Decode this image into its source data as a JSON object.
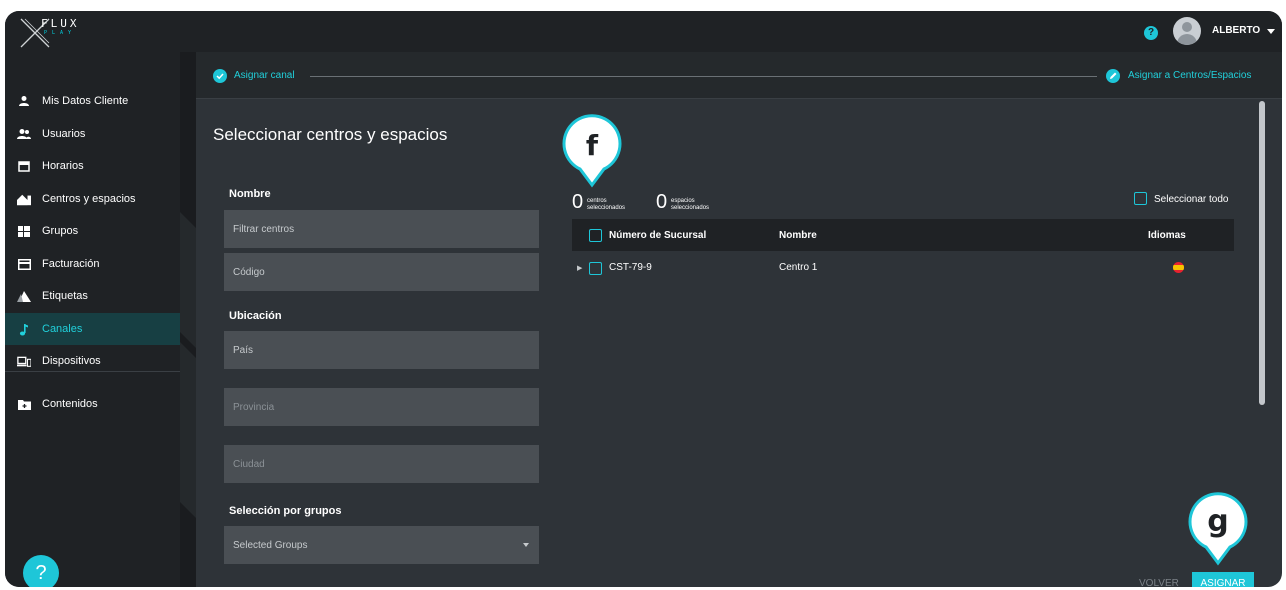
{
  "app": {
    "logo_text": "FLUX",
    "logo_sub": "PLAY"
  },
  "header": {
    "help_icon": "question-circle-icon",
    "user_name": "ALBERTO"
  },
  "sidebar": {
    "items": [
      {
        "label": "Mis Datos Cliente",
        "icon": "user-icon"
      },
      {
        "label": "Usuarios",
        "icon": "users-icon"
      },
      {
        "label": "Horarios",
        "icon": "calendar-icon"
      },
      {
        "label": "Centros y espacios",
        "icon": "building-icon"
      },
      {
        "label": "Grupos",
        "icon": "grid-icon"
      },
      {
        "label": "Facturación",
        "icon": "card-icon"
      },
      {
        "label": "Etiquetas",
        "icon": "tags-icon"
      },
      {
        "label": "Canales",
        "icon": "music-note-icon",
        "active": true
      },
      {
        "label": "Dispositivos",
        "icon": "devices-icon"
      },
      {
        "label": "Contenidos",
        "icon": "folder-icon"
      }
    ],
    "help_label": "?"
  },
  "stepper": {
    "step1": "Asignar canal",
    "step2": "Asignar a Centros/Espacios"
  },
  "filters": {
    "title": "Seleccionar centros y espacios",
    "nombre_label": "Nombre",
    "filtrar_placeholder": "Filtrar centros",
    "codigo_placeholder": "Código",
    "ubicacion_label": "Ubicación",
    "pais_placeholder": "País",
    "provincia_placeholder": "Provincia",
    "ciudad_placeholder": "Ciudad",
    "grupos_label": "Selección por grupos",
    "grupos_value": "Selected Groups"
  },
  "counts": {
    "centros_value": "0",
    "centros_label_1": "centros",
    "centros_label_2": "seleccionados",
    "espacios_value": "0",
    "espacios_label_1": "espacios",
    "espacios_label_2": "seleccionados"
  },
  "select_all": "Seleccionar todo",
  "table": {
    "headers": [
      "Número de Sucursal",
      "Nombre",
      "Idiomas"
    ],
    "rows": [
      {
        "sucursal": "CST-79-9",
        "nombre": "Centro 1",
        "idioma": "es-flag"
      }
    ]
  },
  "markers": {
    "f": "f",
    "g": "g"
  },
  "actions": {
    "volver": "VOLVER",
    "asignar": "ASIGNAR"
  },
  "colors": {
    "accent": "#1ec6d8",
    "sidebar_bg": "#1f2225",
    "content_bg": "#2e3338",
    "field_bg": "#4a4f54"
  }
}
